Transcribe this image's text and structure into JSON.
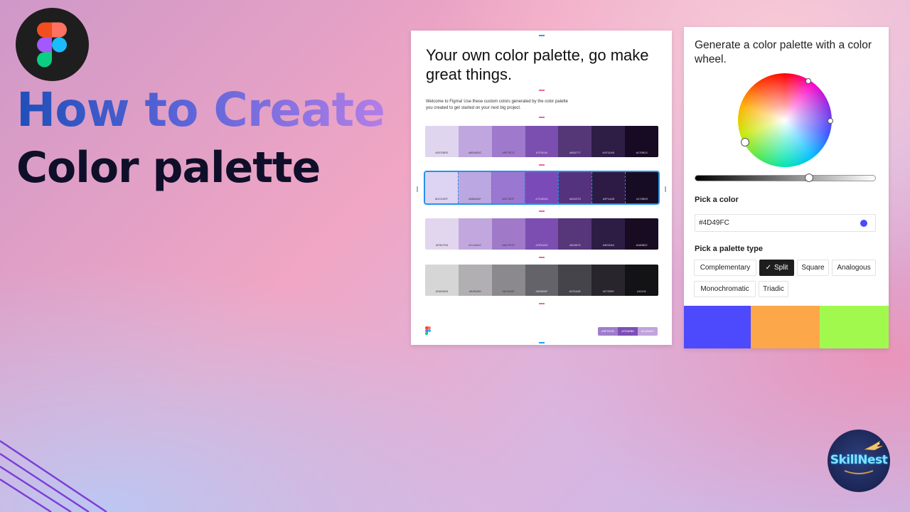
{
  "title": {
    "line1": "How to Create",
    "line2": "Color palette"
  },
  "icons": {
    "figma_badge": "figma-logo-icon",
    "doc_logo": "figma-logo-icon",
    "check": "check-icon",
    "brand_logo": "skillnest-logo"
  },
  "palette_doc": {
    "heading": "Your own color palette, go make great things.",
    "intro": "Welcome to Figma! Use these custom colors generated by the color palette you created to get started on your next big project.",
    "rows": [
      {
        "colors": [
          "#E0D5EE",
          "#BFA6DE",
          "#9F79CC",
          "#7B4FB0",
          "#553777",
          "#2E1D45",
          "#170B23"
        ],
        "labels": [
          "#DFD5EE",
          "#BEA8DC",
          "#9F7ECS",
          "#7F52A0",
          "#563777",
          "#1F1D45",
          "#170B13"
        ]
      },
      {
        "colors": [
          "#DDD3F2",
          "#BBA7E1",
          "#9A77D0",
          "#7A4BB8",
          "#55327D",
          "#2D1A45",
          "#160C24"
        ],
        "labels": [
          "#DCD2EF",
          "#BBA6DF",
          "#9C78CF",
          "#7D4ED6",
          "#54327D",
          "#2F1A45",
          "#170B29"
        ]
      },
      {
        "colors": [
          "#E2D6EE",
          "#C2A7DF",
          "#A07AC9",
          "#7C4EB1",
          "#573679",
          "#2D1C44",
          "#180C22"
        ],
        "labels": [
          "#E5D7E8",
          "#C1A4DC",
          "#A07ECE",
          "#7E54AD",
          "#543679",
          "#301E46",
          "#180B22"
        ]
      },
      {
        "colors": [
          "#D6D6D6",
          "#B1AFB2",
          "#8B898D",
          "#65636A",
          "#46444B",
          "#28262C",
          "#131214"
        ],
        "labels": [
          "#D6D6D6",
          "#B2B0B0",
          "#8C8A8E",
          "#6B6B6F",
          "#474A4E",
          "#272529",
          "#11131"
        ]
      }
    ],
    "footer_pills": [
      {
        "label": "#9F7DCB",
        "color": "#9F7DCB"
      },
      {
        "label": "#7D4EB8",
        "color": "#7D4EB8"
      },
      {
        "label": "#C1A4DC",
        "color": "#C1A4DC"
      }
    ]
  },
  "wheel_panel": {
    "heading": "Generate a color palette with a color wheel.",
    "brightness": 0.63,
    "pick_color_label": "Pick a color",
    "hex_value": "#4D49FC",
    "hex_color": "#4D49FC",
    "palette_type_label": "Pick a palette type",
    "palette_types": [
      "Complementary",
      "Split",
      "Square",
      "Analogous",
      "Monochromatic",
      "Triadic"
    ],
    "selected_type": "Split",
    "result_colors": [
      "#4D49FC",
      "#FDA74B",
      "#A2F94E"
    ]
  },
  "brand": {
    "name": "SkillNest"
  }
}
